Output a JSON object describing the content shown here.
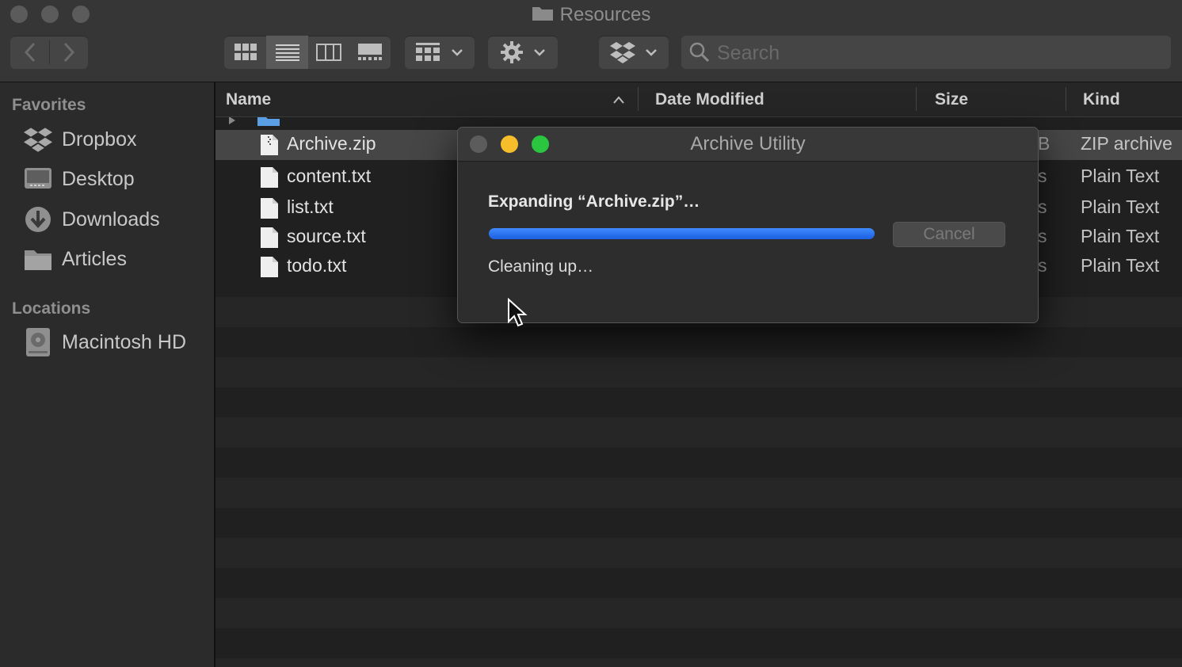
{
  "window": {
    "title": "Resources"
  },
  "toolbar": {
    "search_placeholder": "Search",
    "view_modes": [
      "icon-view",
      "list-view",
      "column-view",
      "gallery-view"
    ],
    "active_view": "list-view"
  },
  "sidebar": {
    "favorites_label": "Favorites",
    "favorites": [
      {
        "label": "Dropbox",
        "icon": "dropbox-icon"
      },
      {
        "label": "Desktop",
        "icon": "desktop-icon"
      },
      {
        "label": "Downloads",
        "icon": "downloads-icon"
      },
      {
        "label": "Articles",
        "icon": "folder-icon"
      }
    ],
    "locations_label": "Locations",
    "locations": [
      {
        "label": "Macintosh HD",
        "icon": "hard-drive-icon"
      }
    ]
  },
  "columns": {
    "name": "Name",
    "date": "Date Modified",
    "size": "Size",
    "kind": "Kind"
  },
  "files": [
    {
      "name": "Archive.zip",
      "size": "B",
      "kind": "ZIP archive",
      "selected": true
    },
    {
      "name": "content.txt",
      "size": "s",
      "kind": "Plain Text"
    },
    {
      "name": "list.txt",
      "size": "s",
      "kind": "Plain Text"
    },
    {
      "name": "source.txt",
      "size": "s",
      "kind": "Plain Text"
    },
    {
      "name": "todo.txt",
      "size": "s",
      "kind": "Plain Text"
    }
  ],
  "dialog": {
    "title": "Archive Utility",
    "heading": "Expanding “Archive.zip”…",
    "progress": 1.0,
    "cancel_label": "Cancel",
    "status": "Cleaning up…"
  },
  "colors": {
    "progress": "#2f78f5",
    "close": "#5c5c5c",
    "minimize": "#f6be2b",
    "zoom": "#2ac63f"
  }
}
